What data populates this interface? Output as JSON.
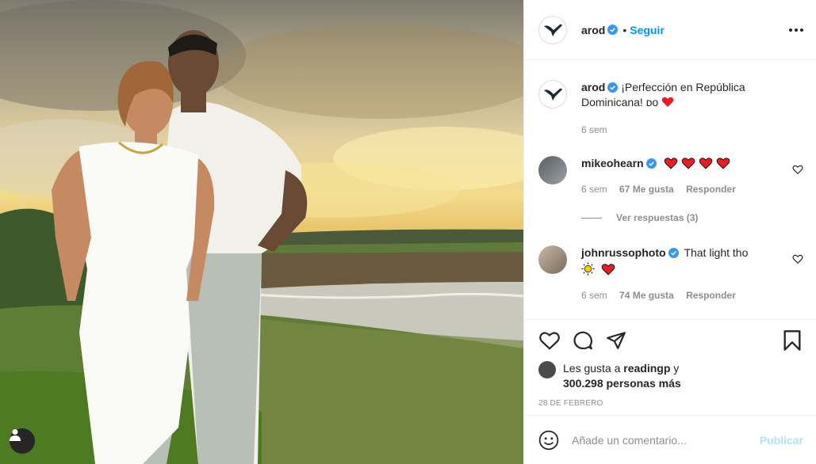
{
  "post_image": {
    "alt_icon": "user-tag-icon"
  },
  "header": {
    "username": "arod",
    "separator": "•",
    "follow_label": "Seguir",
    "more_icon": "more-options-icon"
  },
  "caption": {
    "username": "arod",
    "text": "¡Perfección en República Dominicana! ᴅᴏ",
    "time": "6 sem"
  },
  "comments": [
    {
      "username": "mikeohearn",
      "text": "",
      "emoji": "heart-x4",
      "time": "6 sem",
      "likes": "67 Me gusta",
      "reply_label": "Responder"
    },
    {
      "username": "johnrussophoto",
      "text": "That light tho",
      "emoji": "sun-heart",
      "time": "6 sem",
      "likes": "74 Me gusta",
      "reply_label": "Responder"
    }
  ],
  "view_replies": "Ver respuestas (3)",
  "likes": {
    "prefix": "Les gusta a",
    "user": "readingp",
    "conj": "y",
    "count": "300.298 personas más"
  },
  "post_date": "28 DE FEBRERO",
  "add_comment": {
    "placeholder": "Añade un comentario...",
    "publish_label": "Publicar"
  },
  "colors": {
    "accent": "#0095f6",
    "heart": "#ed4956",
    "verified": "#3897f0"
  }
}
